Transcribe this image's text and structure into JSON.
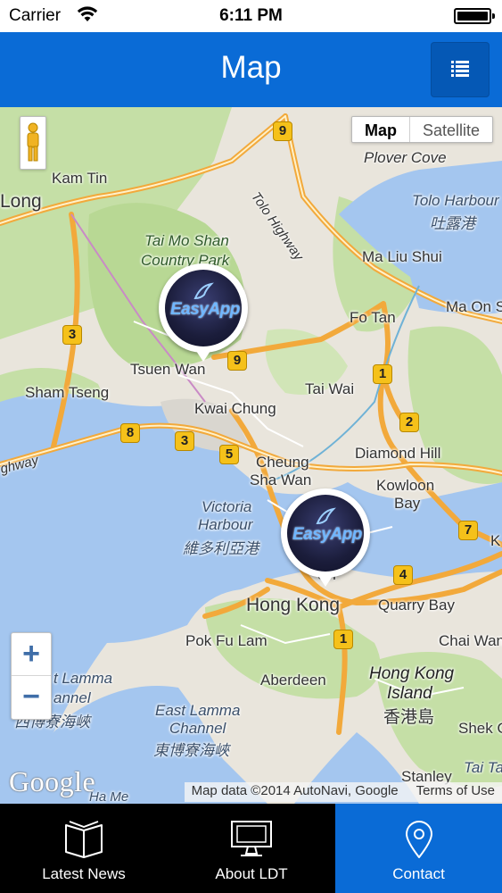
{
  "status_bar": {
    "carrier": "Carrier",
    "time": "6:11 PM",
    "icons": [
      "wifi-icon",
      "battery-icon"
    ]
  },
  "nav": {
    "title": "Map",
    "menu_icon": "list-icon"
  },
  "map": {
    "type_control": {
      "map": "Map",
      "satellite": "Satellite",
      "selected": "Map"
    },
    "labels": {
      "kam_tin": "Kam Tin",
      "long": "Long",
      "tai_mo_shan": "Tai Mo Shan",
      "country_park": "Country Park",
      "tolo_highway": "Tolo Highway",
      "plover_cove": "Plover Cove",
      "tolo_harbour": "Tolo Harbour",
      "tolo_harbour_zh": "吐露港",
      "ma_liu_shui": "Ma Liu Shui",
      "ma_on_shan": "Ma On S",
      "fo_tan": "Fo Tan",
      "tsuen_wan": "Tsuen Wan",
      "tai_wai": "Tai Wai",
      "sham_tseng": "Sham Tseng",
      "kwai_chung": "Kwai Chung",
      "diamond_hill": "Diamond Hill",
      "highway": "ghway",
      "cheung_sha_wan_1": "Cheung",
      "cheung_sha_wan_2": "Sha Wan",
      "kowloon_bay_1": "Kowloon",
      "kowloon_bay_2": "Bay",
      "victoria_harbour_1": "Victoria",
      "victoria_harbour_2": "Harbour",
      "victoria_harbour_zh": "維多利亞港",
      "sheung_wan": "Sh",
      "hong_kong": "Hong Kong",
      "quarry_bay": "Quarry Bay",
      "pok_fu_lam": "Pok Fu Lam",
      "chai_wan": "Chai Wan",
      "lamma_1": "t Lamma",
      "lamma_2": "annel",
      "lamma_zh": "西博寮海峽",
      "aberdeen": "Aberdeen",
      "hk_island_1": "Hong Kong",
      "hk_island_2": "Island",
      "hk_island_zh": "香港島",
      "east_lamma_1": "East Lamma",
      "east_lamma_2": "Channel",
      "east_lamma_zh": "東博寮海峽",
      "shek_o": "Shek O",
      "stanley": "Stanley",
      "tai_tam": "Tai Ta",
      "ha_mei": "Ha Me",
      "kw": "K"
    },
    "route_shields": [
      "9",
      "9",
      "3",
      "3",
      "8",
      "5",
      "1",
      "2",
      "4",
      "7",
      "1"
    ],
    "markers": [
      {
        "name": "EasyApp"
      },
      {
        "name": "EasyApp"
      }
    ],
    "zoom": {
      "in": "+",
      "out": "−"
    },
    "google_logo": "Google",
    "attribution": "Map data ©2014 AutoNavi, Google",
    "terms": "Terms of Use"
  },
  "tabs": [
    {
      "label": "Latest News",
      "icon": "book-icon",
      "active": false
    },
    {
      "label": "About LDT",
      "icon": "monitor-icon",
      "active": false
    },
    {
      "label": "Contact",
      "icon": "location-pin-icon",
      "active": true
    }
  ],
  "colors": {
    "accent": "#0a6bd6",
    "tab_bar": "#000000",
    "water": "#a4c6ef",
    "land": "#e9e5dc",
    "park": "#c5dfa6",
    "highway": "#f2a93b"
  }
}
